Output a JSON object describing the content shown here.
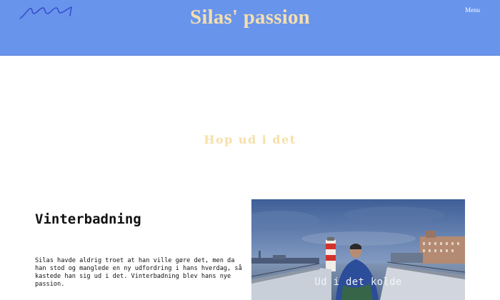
{
  "header": {
    "title": "Silas' passion",
    "menu_label": "Menu",
    "background_color": "#6894ec",
    "title_color": "#f5dfae"
  },
  "hero": {
    "heading": "Hop ud i det",
    "heading_color": "#f6dfa9"
  },
  "section": {
    "title": "Vinterbadning",
    "body": "Silas havde aldrig troet at han ville gøre det, men da han stod og manglede en ny udfordring i hans hverdag, så kastede han sig ud i det. Vinterbadning blev hans nye passion."
  },
  "photo": {
    "caption": "Ud i det kolde",
    "subject": "winter-bathing-harbor-photo"
  }
}
